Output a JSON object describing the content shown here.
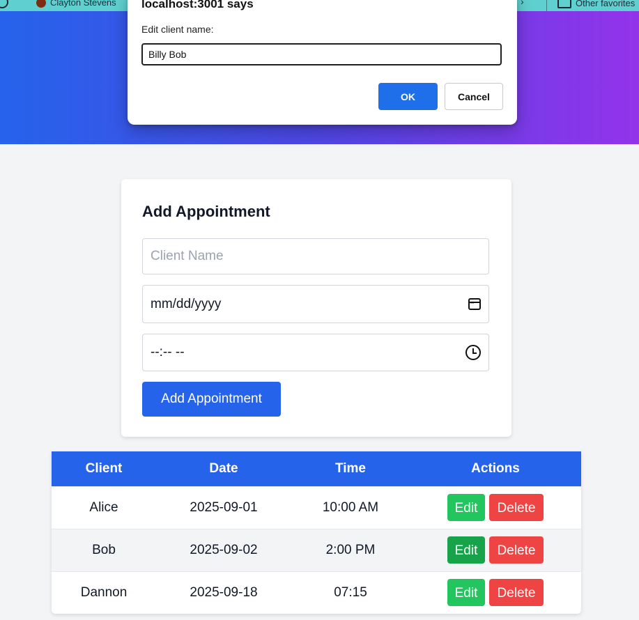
{
  "browser": {
    "bookmark_left_label": "Clayton Stevens",
    "bookmark_right_label": "Other favorites"
  },
  "dialog": {
    "title": "localhost:3001 says",
    "message": "Edit client name:",
    "input_value": "Billy Bob",
    "ok_label": "OK",
    "cancel_label": "Cancel"
  },
  "form": {
    "title": "Add Appointment",
    "client_placeholder": "Client Name",
    "date_placeholder": "mm/dd/yyyy",
    "time_placeholder": "--:-- --",
    "submit_label": "Add Appointment"
  },
  "table": {
    "headers": [
      "Client",
      "Date",
      "Time",
      "Actions"
    ],
    "edit_label": "Edit",
    "delete_label": "Delete",
    "rows": [
      {
        "client": "Alice",
        "date": "2025-09-01",
        "time": "10:00 AM"
      },
      {
        "client": "Bob",
        "date": "2025-09-02",
        "time": "2:00 PM"
      },
      {
        "client": "Dannon",
        "date": "2025-09-18",
        "time": "07:15"
      }
    ]
  },
  "colors": {
    "primary": "#2563eb",
    "gradient_end": "#9333ea",
    "edit": "#22c55e",
    "delete": "#ef4444",
    "dialog_ok": "#1f6feb"
  },
  "icons": [
    "calendar-icon",
    "clock-icon"
  ]
}
